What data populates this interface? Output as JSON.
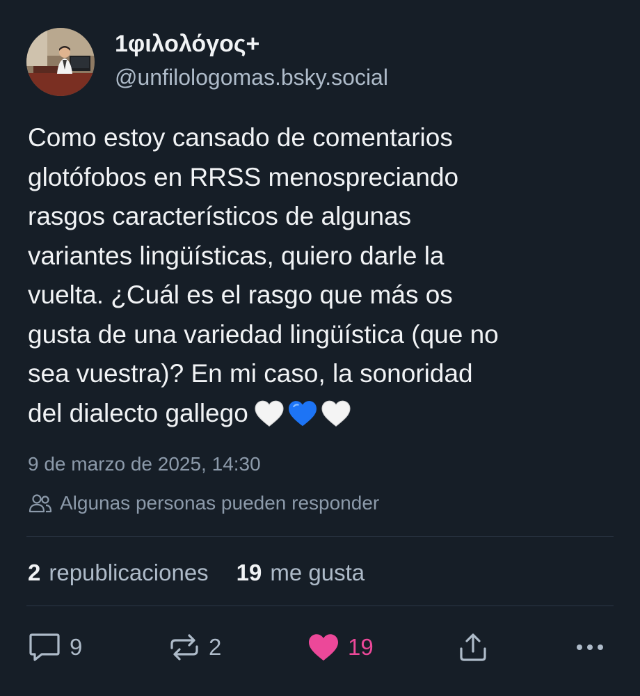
{
  "post": {
    "author": {
      "display_name": "1φιλολόγος+",
      "handle": "@unfilologomas.bsky.social"
    },
    "text_lines": [
      "Como estoy cansado de comentarios",
      "glotófobos en RRSS menospreciando",
      "rasgos característicos de algunas",
      "variantes lingüísticas, quiero darle la",
      "vuelta. ¿Cuál es el rasgo que más os",
      "gusta de una variedad lingüística (que no",
      "sea vuestra)? En mi caso, la sonoridad",
      "del dialecto gallego"
    ],
    "emoji": [
      "white-heart",
      "blue-heart",
      "white-heart"
    ],
    "timestamp": "9 de marzo de 2025, 14:30",
    "reply_setting": "Algunas personas pueden responder",
    "stats": {
      "reposts_count": "2",
      "reposts_label": "republicaciones",
      "likes_count": "19",
      "likes_label": "me gusta"
    },
    "actions": {
      "reply_count": "9",
      "repost_count": "2",
      "like_count": "19",
      "liked": true
    }
  },
  "colors": {
    "background": "#161e27",
    "text_primary": "#f1f3f5",
    "text_secondary": "#aebbc9",
    "text_muted": "#8c9aaa",
    "like_accent": "#ec4899",
    "heart_blue": "#1d74f5",
    "divider": "#2c3847"
  },
  "icons": {
    "reply": "speech-bubble-icon",
    "repost": "repost-arrows-icon",
    "like": "heart-icon",
    "share": "share-upload-icon",
    "more": "ellipsis-icon",
    "reply_setting": "people-icon"
  }
}
